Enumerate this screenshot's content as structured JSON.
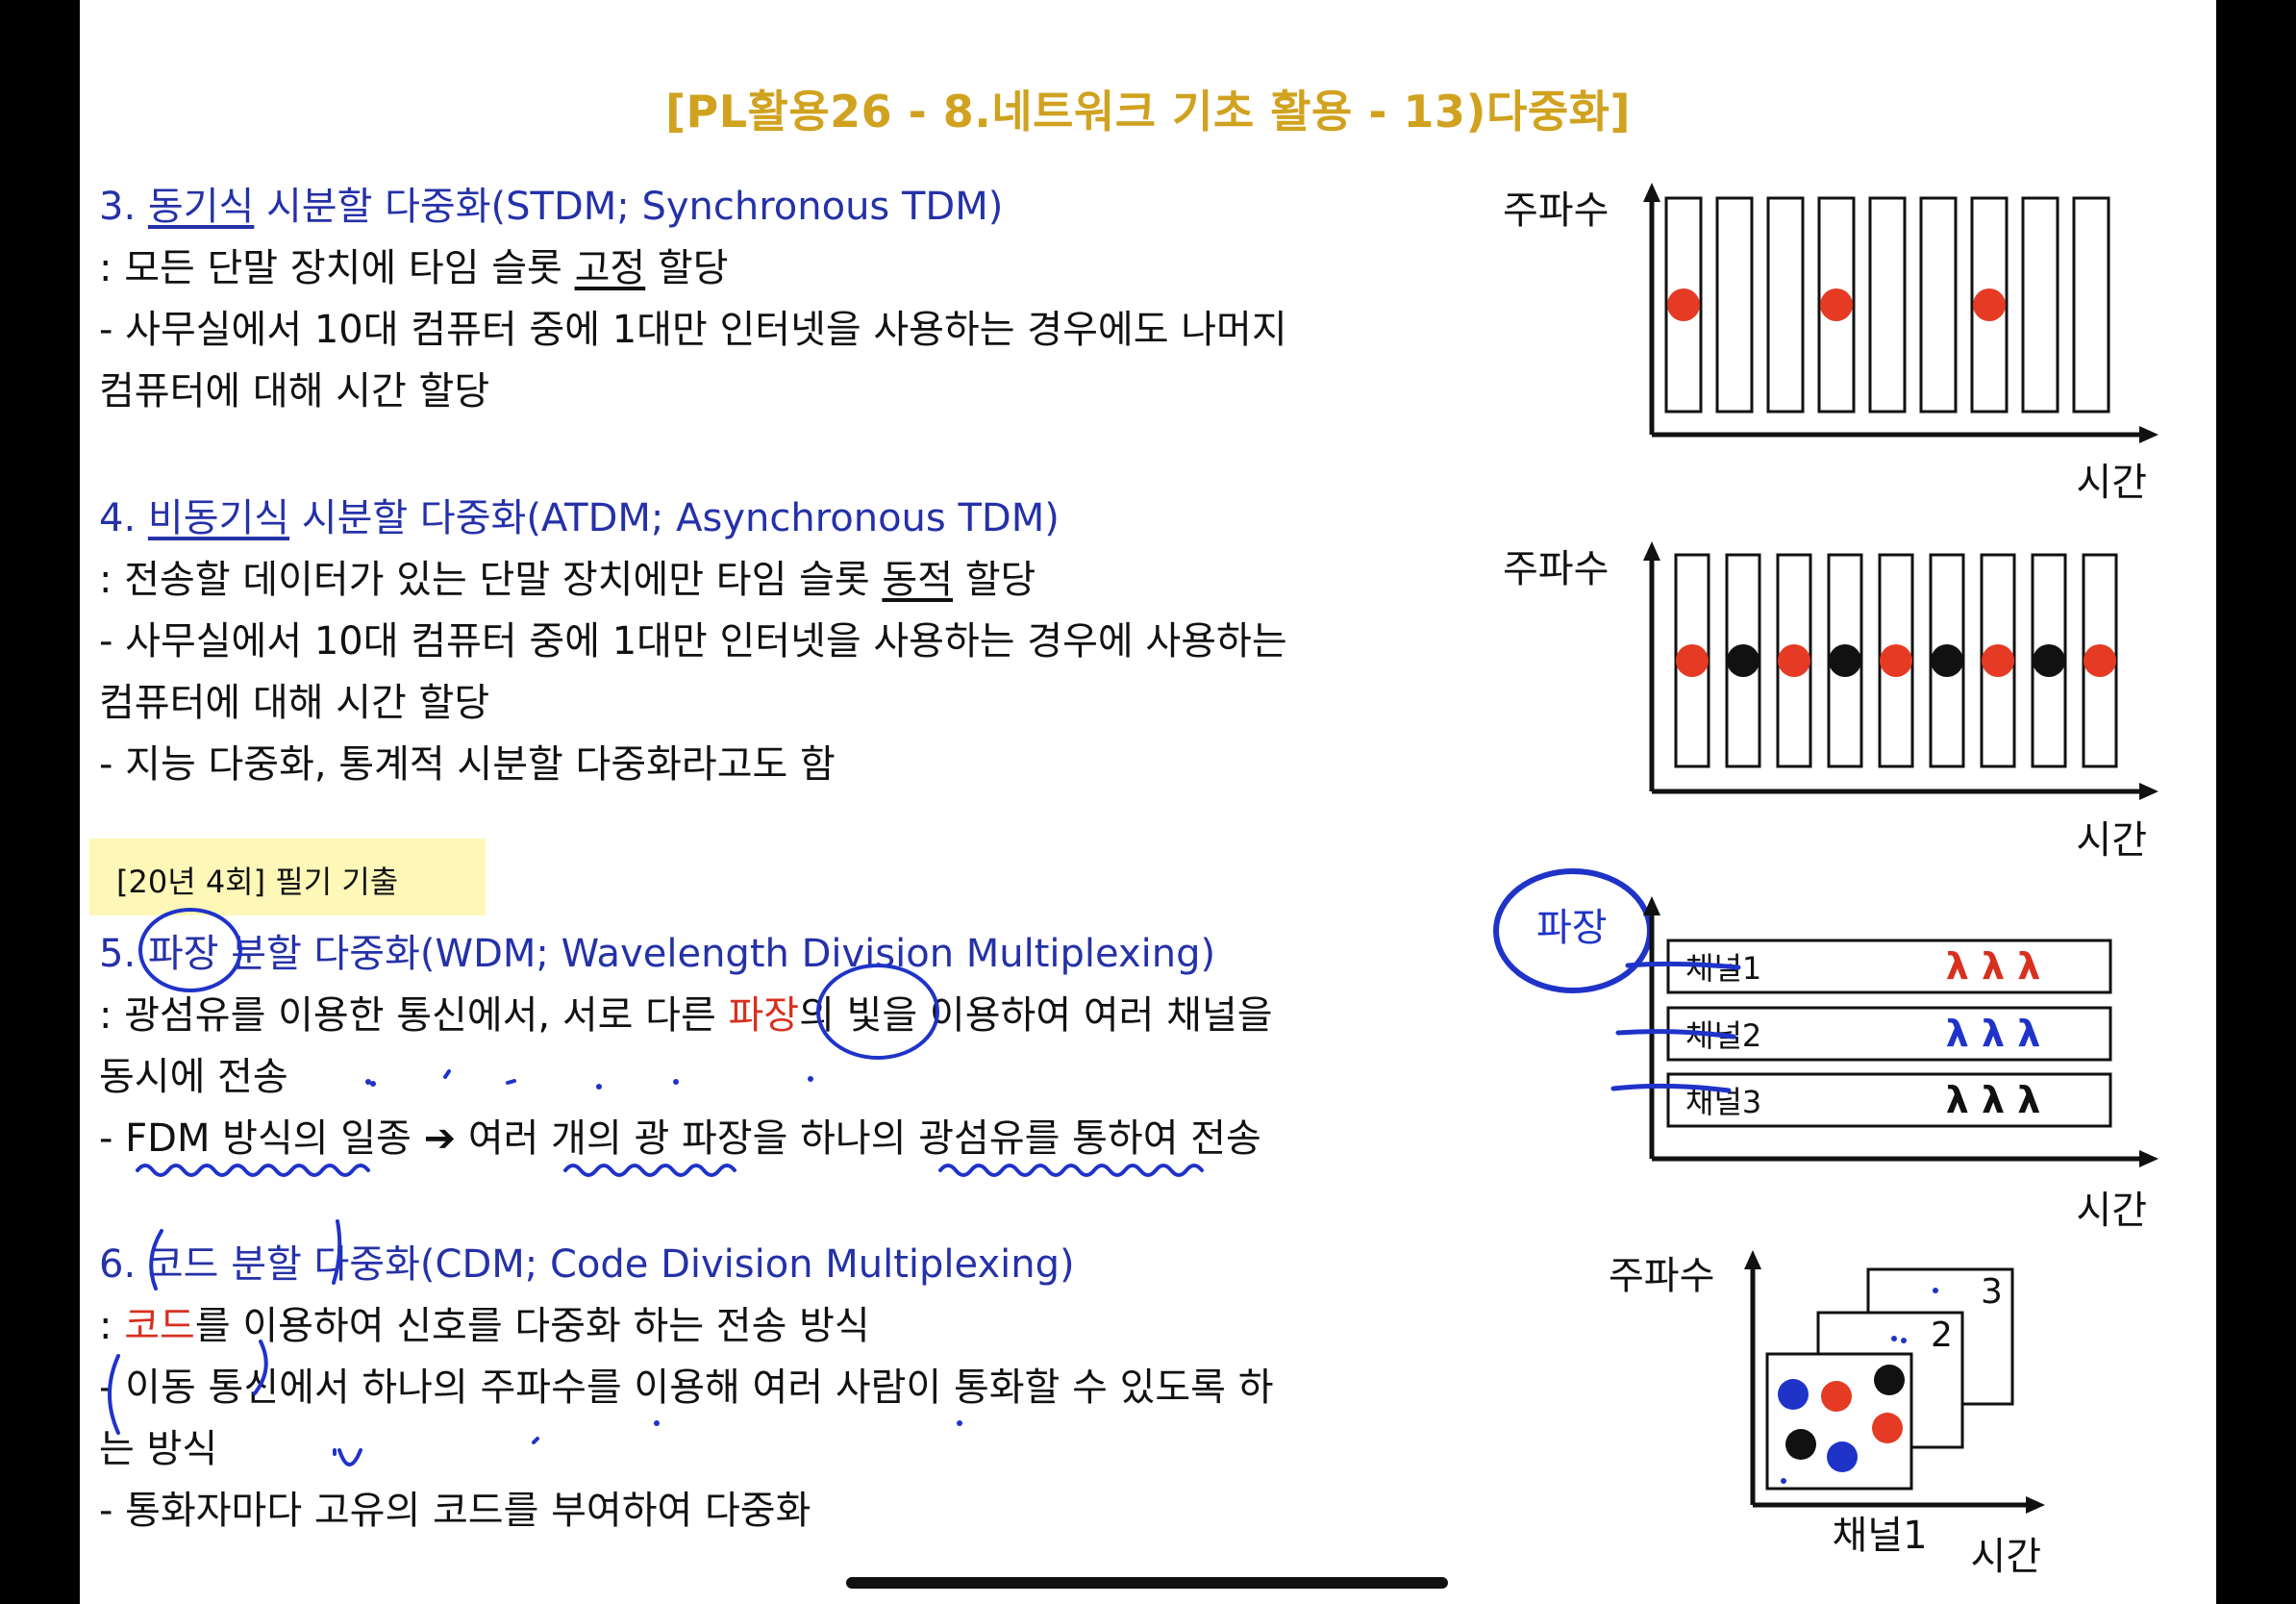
{
  "title": "[PL활용26 - 8.네트워크 기초 활용 - 13)다중화]",
  "sections": {
    "stdm": {
      "num": "3.",
      "head_u": "동기식",
      "head_rest": " 시분할 다중화(STDM; Synchronous TDM)",
      "l1_a": ": 모든 단말 장치에 타임 슬롯 ",
      "l1_u": "고정",
      "l1_b": " 할당",
      "l2": "- 사무실에서 10대 컴퓨터 중에 1대만 인터넷을 사용하는 경우에도 나머지",
      "l3": "컴퓨터에 대해 시간 할당"
    },
    "atdm": {
      "num": "4.",
      "head_u": "비동기식",
      "head_rest": " 시분할 다중화(ATDM; Asynchronous TDM)",
      "l1_a": ": 전송할 데이터가 있는 단말 장치에만 타임 슬롯 ",
      "l1_u": "동적",
      "l1_b": " 할당",
      "l2": "- 사무실에서 10대 컴퓨터 중에 1대만 인터넷을 사용하는 경우에 사용하는",
      "l3": "컴퓨터에 대해 시간 할당",
      "l4": "- 지능 다중화, 통계적 시분할 다중화라고도 함"
    },
    "exam_tag": "[20년 4회] 필기 기출",
    "wdm": {
      "head": "5. 파장 분할 다중화(WDM; Wavelength Division Multiplexing)",
      "l1_a": ": 광섬유를 이용한 통신에서, 서로 다른 ",
      "l1_red": "파장",
      "l1_b": "의 빛을 이용하여 여러 채널을",
      "l2": "동시에 전송",
      "l3": "- FDM 방식의 일종 ➔ 여러 개의 광 파장을 하나의 광섬유를 통하여 전송"
    },
    "cdm": {
      "head": "6. 코드 분할 다중화(CDM; Code Division Multiplexing)",
      "l1_a": ": ",
      "l1_red": "코드",
      "l1_b": "를 이용하여 신호를 다중화 하는 전송 방식",
      "l2": "- 이동 통신에서 하나의 주파수를 이용해 여러 사람이 통화할 수 있도록 하",
      "l3": "는 방식",
      "l4": "- 통화자마다 고유의 코드를 부여하여 다중화"
    }
  },
  "diagrams": {
    "freq": "주파수",
    "time": "시간",
    "wave": "파장",
    "channels": [
      {
        "name": "채널1",
        "lambdas": "λ λ λ",
        "color": "#d8301f"
      },
      {
        "name": "채널2",
        "lambdas": "λ λ λ",
        "color": "#1f33c9"
      },
      {
        "name": "채널3",
        "lambdas": "λ λ λ",
        "color": "#111111"
      }
    ],
    "cdm_layers": [
      "3",
      "2"
    ],
    "cdm_channel": "채널1"
  },
  "colors": {
    "title": "#d0a21f",
    "heading": "#2531a8",
    "highlight": "#d8301f",
    "ink": "#1f33c9",
    "tag_bg": "#fdf7b8"
  }
}
